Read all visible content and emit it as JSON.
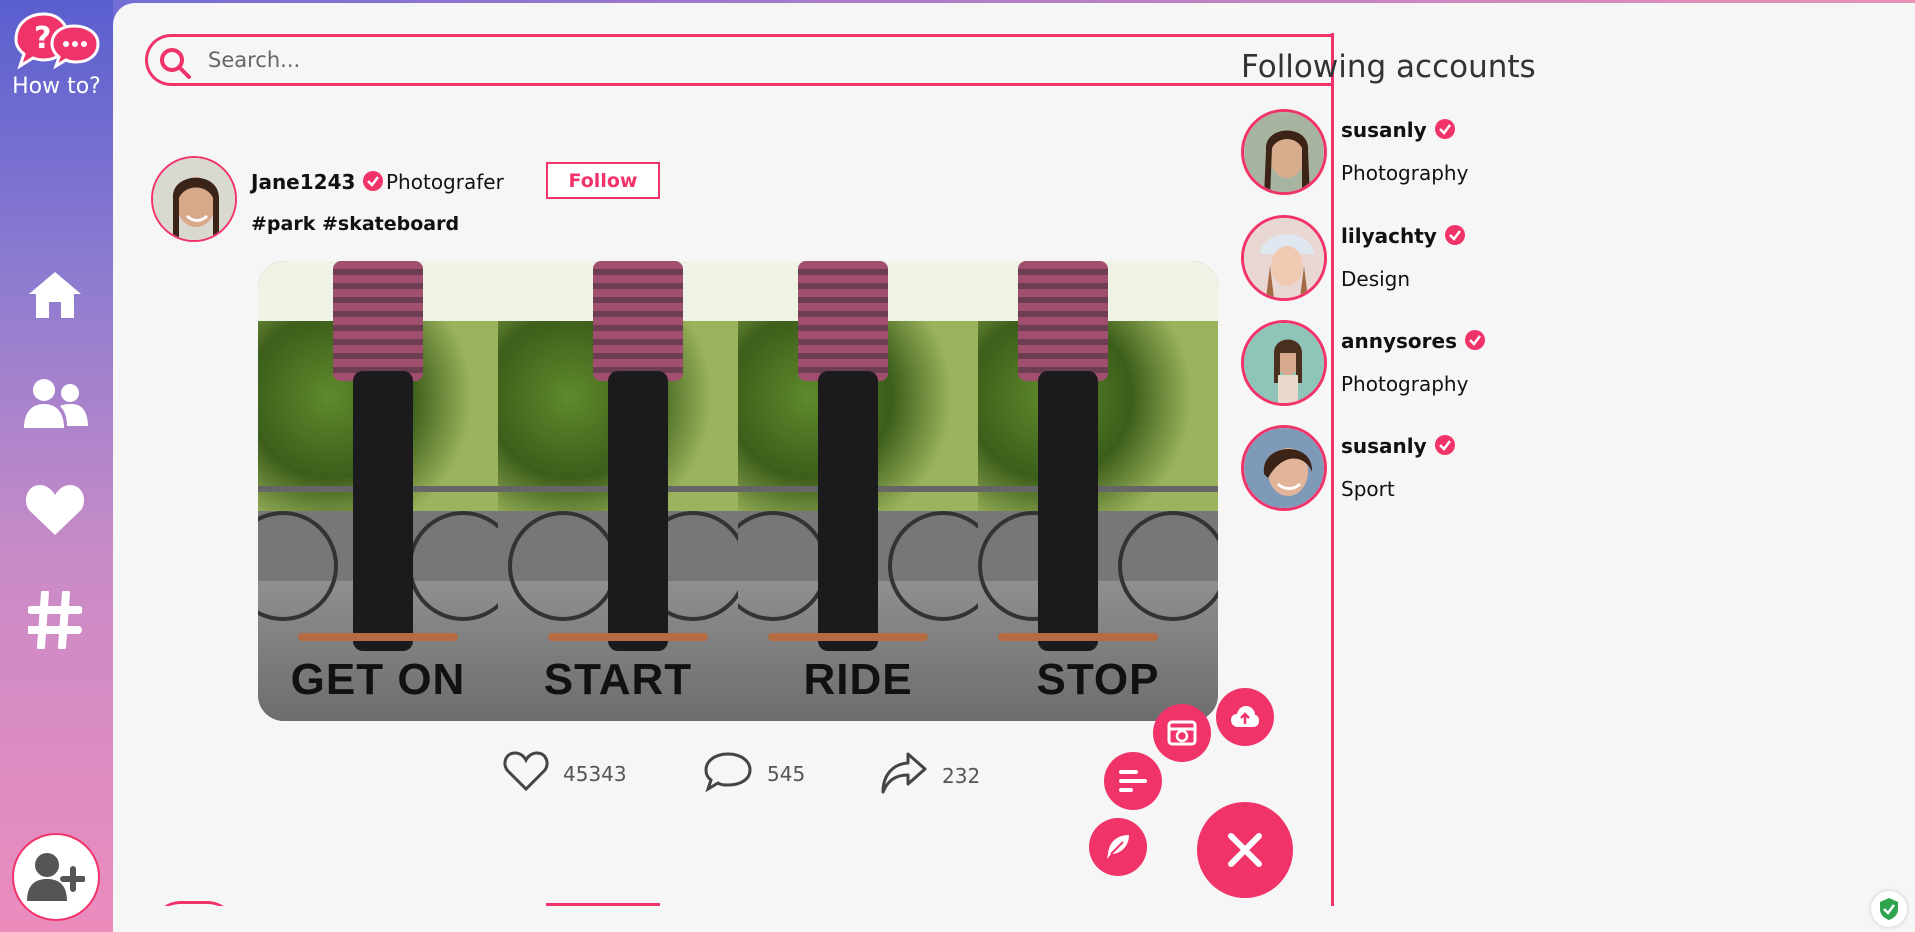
{
  "app": {
    "logo_text": "How to?"
  },
  "search": {
    "placeholder": "Search..."
  },
  "nav": [
    "home-icon",
    "users-icon",
    "heart-icon",
    "hashtag-icon"
  ],
  "post": {
    "username": "Jane1243",
    "role": "Photografer",
    "follow_label": "Follow",
    "hashtags": "#park #skateboard",
    "image_labels": [
      "GET ON",
      "START",
      "RIDE",
      "STOP"
    ],
    "likes": "45343",
    "comments": "545",
    "shares": "232"
  },
  "following": {
    "title": "Following accounts",
    "accounts": [
      {
        "name": "susanly",
        "category": "Photography"
      },
      {
        "name": "lilyachty",
        "category": "Design"
      },
      {
        "name": "annysores",
        "category": "Photography"
      },
      {
        "name": "susanly",
        "category": "Sport"
      }
    ]
  },
  "colors": {
    "accent": "#f0346a",
    "background": "#f6f6f6"
  }
}
